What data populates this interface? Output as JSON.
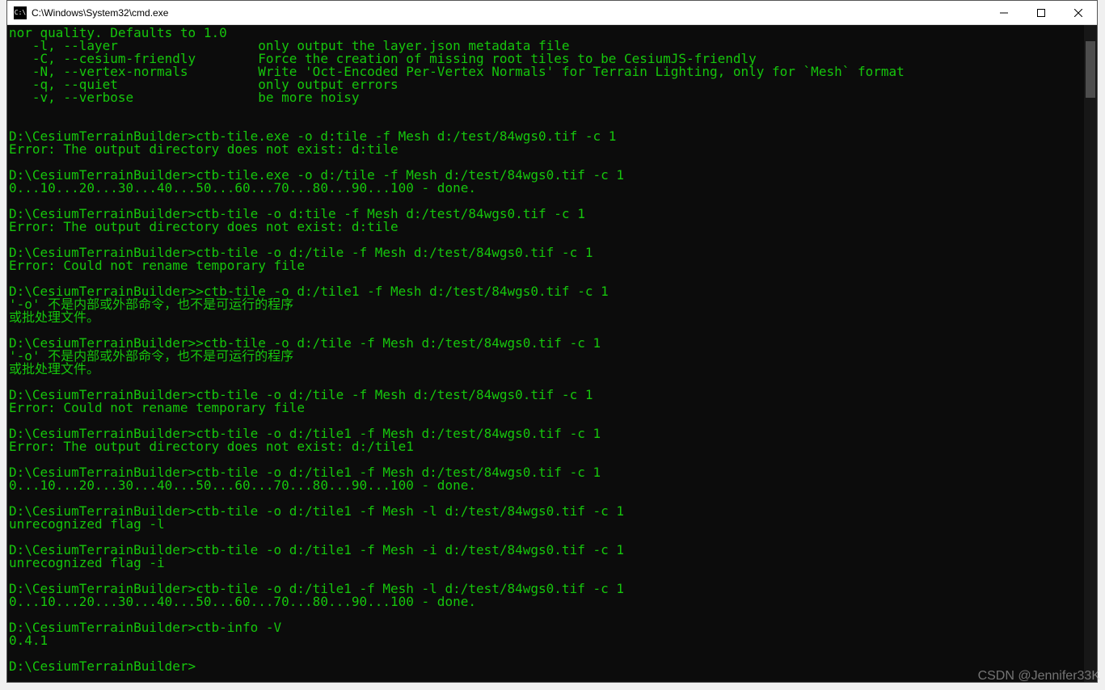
{
  "window": {
    "title": "C:\\Windows\\System32\\cmd.exe",
    "icon_label": "C:\\"
  },
  "terminal": {
    "lines": [
      "nor quality. Defaults to 1.0",
      "   -l, --layer                  only output the layer.json metadata file",
      "   -C, --cesium-friendly        Force the creation of missing root tiles to be CesiumJS-friendly",
      "   -N, --vertex-normals         Write 'Oct-Encoded Per-Vertex Normals' for Terrain Lighting, only for `Mesh` format",
      "   -q, --quiet                  only output errors",
      "   -v, --verbose                be more noisy",
      "",
      "",
      "D:\\CesiumTerrainBuilder>ctb-tile.exe -o d:tile -f Mesh d:/test/84wgs0.tif -c 1",
      "Error: The output directory does not exist: d:tile",
      "",
      "D:\\CesiumTerrainBuilder>ctb-tile.exe -o d:/tile -f Mesh d:/test/84wgs0.tif -c 1",
      "0...10...20...30...40...50...60...70...80...90...100 - done.",
      "",
      "D:\\CesiumTerrainBuilder>ctb-tile -o d:tile -f Mesh d:/test/84wgs0.tif -c 1",
      "Error: The output directory does not exist: d:tile",
      "",
      "D:\\CesiumTerrainBuilder>ctb-tile -o d:/tile -f Mesh d:/test/84wgs0.tif -c 1",
      "Error: Could not rename temporary file",
      "",
      "D:\\CesiumTerrainBuilder>>ctb-tile -o d:/tile1 -f Mesh d:/test/84wgs0.tif -c 1",
      "'-o' 不是内部或外部命令，也不是可运行的程序",
      "或批处理文件。",
      "",
      "D:\\CesiumTerrainBuilder>>ctb-tile -o d:/tile -f Mesh d:/test/84wgs0.tif -c 1",
      "'-o' 不是内部或外部命令，也不是可运行的程序",
      "或批处理文件。",
      "",
      "D:\\CesiumTerrainBuilder>ctb-tile -o d:/tile -f Mesh d:/test/84wgs0.tif -c 1",
      "Error: Could not rename temporary file",
      "",
      "D:\\CesiumTerrainBuilder>ctb-tile -o d:/tile1 -f Mesh d:/test/84wgs0.tif -c 1",
      "Error: The output directory does not exist: d:/tile1",
      "",
      "D:\\CesiumTerrainBuilder>ctb-tile -o d:/tile1 -f Mesh d:/test/84wgs0.tif -c 1",
      "0...10...20...30...40...50...60...70...80...90...100 - done.",
      "",
      "D:\\CesiumTerrainBuilder>ctb-tile -o d:/tile1 -f Mesh -l d:/test/84wgs0.tif -c 1",
      "unrecognized flag -l",
      "",
      "D:\\CesiumTerrainBuilder>ctb-tile -o d:/tile1 -f Mesh -i d:/test/84wgs0.tif -c 1",
      "unrecognized flag -i",
      "",
      "D:\\CesiumTerrainBuilder>ctb-tile -o d:/tile1 -f Mesh -l d:/test/84wgs0.tif -c 1",
      "0...10...20...30...40...50...60...70...80...90...100 - done.",
      "",
      "D:\\CesiumTerrainBuilder>ctb-info -V",
      "0.4.1",
      "",
      "D:\\CesiumTerrainBuilder>"
    ]
  },
  "watermark": "CSDN @Jennifer33K"
}
